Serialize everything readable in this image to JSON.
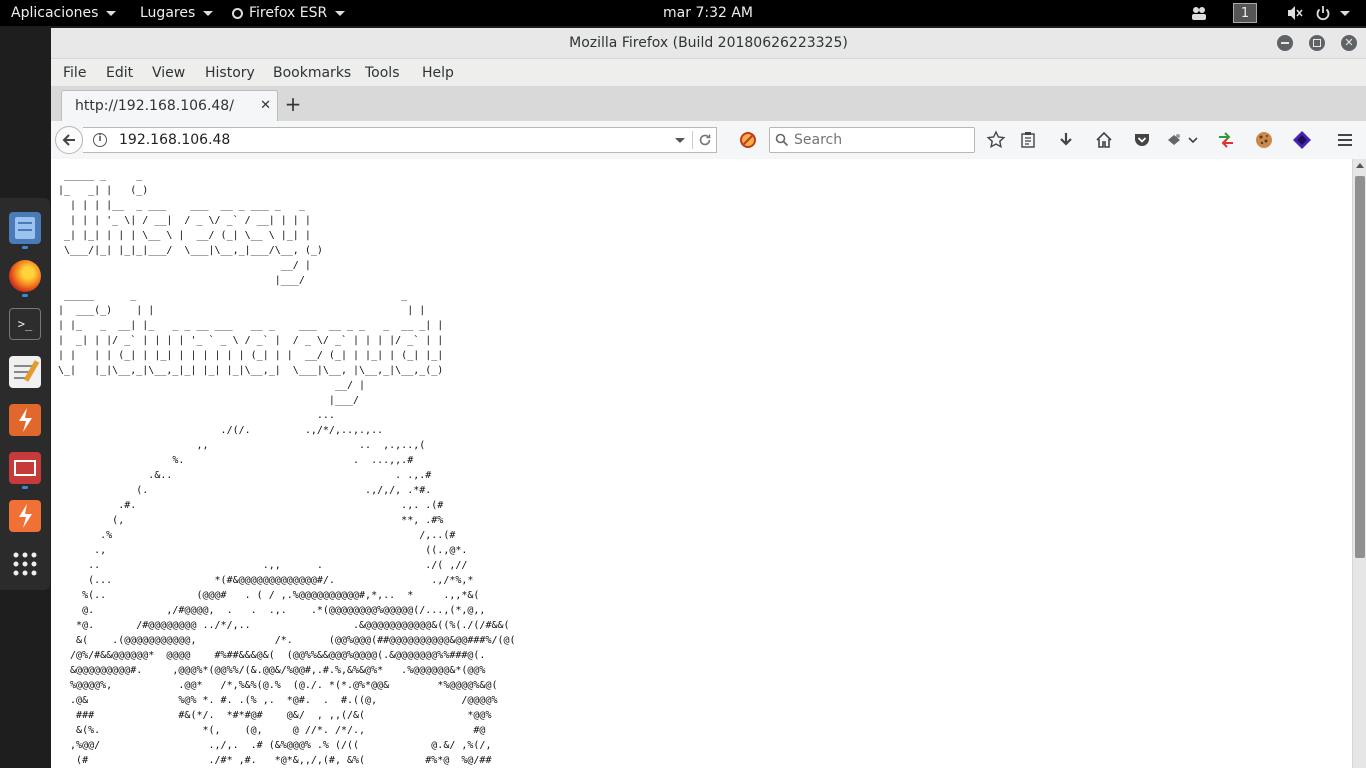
{
  "topbar": {
    "applications": "Aplicaciones",
    "places": "Lugares",
    "active_app": "Firefox ESR",
    "clock": "mar  7:32 AM",
    "workspace": "1"
  },
  "window": {
    "title": "Mozilla Firefox (Build 20180626223325)"
  },
  "menu": {
    "file": "File",
    "edit": "Edit",
    "view": "View",
    "history": "History",
    "bookmarks": "Bookmarks",
    "tools": "Tools",
    "help": "Help"
  },
  "tab": {
    "label": "http://192.168.106.48/"
  },
  "navbar": {
    "url": "192.168.106.48",
    "search_placeholder": "Search"
  },
  "page": {
    "ascii_art": " _____ _     _\n|_   _| |   (_)\n  | | | |__  _ ___    ___  __ _ ___ _   _\n  | | | '_ \\| / __|  / _ \\/ _` / __| | | |\n _| |_| | | | \\__ \\ |  __/ (_| \\__ \\ |_| |\n \\___/|_| |_|_|___/  \\___|\\__,_|___/\\__, (_)\n                                     __/ |\n                                    |___/\n _____      _                                            _\n|  ___(_)    | |                                          | |\n| |_   _  __| |_   _ _ __ ___   __ _    ___  __ _ _   _  __ _| |\n|  _| | |/ _` | | | | '_ ` _ \\ / _` |  / _ \\/ _` | | | |/ _` | |\n| |   | | (_| | |_| | | | | | | (_| | |  __/ (_| | |_| | (_| |_|\n\\_|   |_|\\__,_|\\__,_|_| |_| |_|\\__,_|  \\___|\\__, |\\__,_|\\__,_(_)\n                                              __/ |\n                                             |___/\n                                           ...\n                           ./(/.         .,/*/,..,.,..\n                       ,,                         ..  ,.,..,(\n                   %.                            .  ...,,.#\n               .&..                                     . .,.#\n             (.                                    .,/,/, .*#.\n          .#.                                            .,. .(#\n         (,                                              **, .#%\n       .%                                                   /,..(#\n      .,                                                     ((.,@*.\n     ..                           .,,      .                 ./( ,//\n     (...                 *(#&@@@@@@@@@@@@@#/.                .,/*%,*\n    %(..               (@@@#   . ( / ,.%@@@@@@@@@@#,*,..  *     .,,*&(\n    @.            ,/#@@@@,  .   .  .,.    .*(@@@@@@@@%@@@@@(/...,(*,@,,\n   *@.       /#@@@@@@@@ ../*/,..                 .&@@@@@@@@@@@&((%(./(/#&&(\n   &(    .(@@@@@@@@@@@,             /*.      (@@%@@@(##@@@@@@@@@@&@@###%/(@(\n  /@%/#&&@@@@@@*  @@@@    #%##&&&@&(  (@@%%&&@@@%@@@@(.&@@@@@@@%%###@(.\n  &@@@@@@@@@#.     ,@@@%*(@@%%/(&.@@&/%@@#,.#.%,&%&@%*   .%@@@@@@&*(@@%\n  %@@@@%,           .@@*   /*,%&%(@.%  (@./. *(*.@%*@@&        *%@@@@%&@(\n  .@&               %@% *. #. .(% ,.  *@#.  .  #.((@,              /@@@@%\n   ###              #&(*/.  *#*#@#    @&/  , ,,(/&(                 *@@%\n   &(%.                 *(,    (@,     @ //*. /*/.,                  #@\n  ,%@@/                  .,/,.  .# (&%@@@% .% (/((            @.&/ ,%(/,\n   (#                    ./#* ,#.   *@*&,,/,(#, &%(          #%*@  %@/##"
  }
}
